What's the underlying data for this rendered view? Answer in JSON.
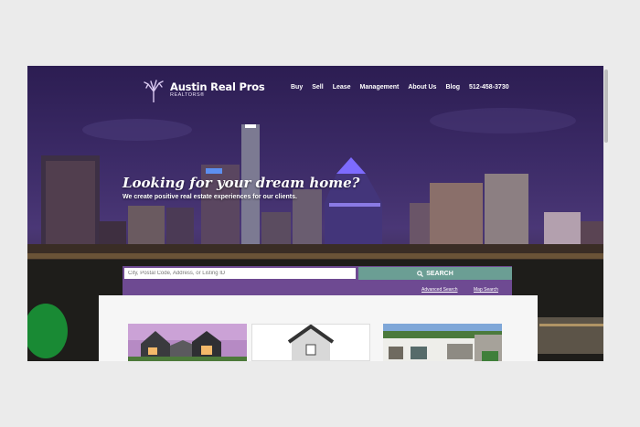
{
  "site": {
    "logo_title": "Austin Real Pros",
    "logo_subtitle": "REALTORS®",
    "logo_icon": "tree-icon"
  },
  "nav": {
    "items": [
      "Buy",
      "Sell",
      "Lease",
      "Management",
      "About Us",
      "Blog"
    ],
    "phone": "512-458-3730"
  },
  "hero": {
    "headline": "Looking for your dream home?",
    "subline": "We create positive real estate experiences for our clients."
  },
  "search": {
    "placeholder": "City, Postal Code, Address, or Listing ID",
    "button_label": "SEARCH",
    "button_icon": "search-icon",
    "advanced_link": "Advanced Search",
    "map_link": "Map Search"
  },
  "colors": {
    "search_bar": "#6e4a92",
    "search_button": "#6b9e94",
    "sky_top": "#2c1d52",
    "panel_bg": "#f6f6f6"
  },
  "listings": [
    {
      "name": "listing-card-modern-house"
    },
    {
      "name": "listing-card-house-icon"
    },
    {
      "name": "listing-card-white-house"
    }
  ]
}
